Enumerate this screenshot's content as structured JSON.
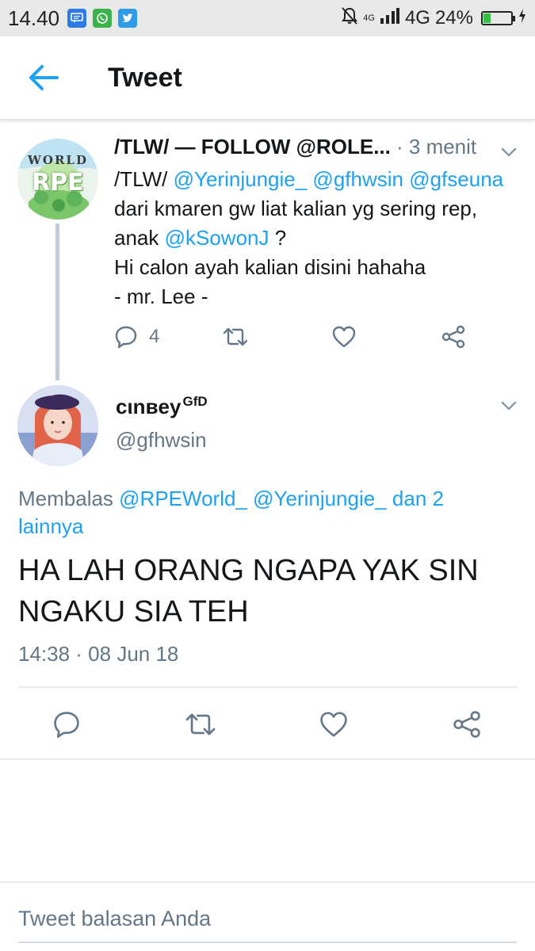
{
  "status_bar": {
    "time": "14.40",
    "network_small": "4G",
    "network": "4G",
    "battery_text": "24%",
    "battery_level": 0.24,
    "notification_icons": [
      "message-icon",
      "whatsapp-icon",
      "twitter-icon"
    ]
  },
  "header": {
    "title": "Tweet",
    "back_icon": "arrow-left-icon"
  },
  "parent_tweet": {
    "name": "/TLW/ — FOLLOW @ROLE...",
    "time": "· 3 menit",
    "avatar_text": "WORLD",
    "avatar_mark": "RPE",
    "text_parts": {
      "p1": "/TLW/ ",
      "m1": "@Yerinjungie_",
      "p2": " ",
      "m2": "@gfhwsin",
      "m3": "@gfseuna",
      "p3": " dari kmaren gw liat kalian yg sering rep, anak ",
      "m4": "@kSowonJ",
      "p4": " ?",
      "line2": "Hi calon ayah kalian disini hahaha",
      "line3": "- mr. Lee -"
    },
    "reply_count": "4"
  },
  "main_tweet": {
    "name": "cιnвey",
    "name_sup": "GfD",
    "handle": "@gfhwsin",
    "reply_prefix": "Membalas ",
    "reply_mentions": "@RPEWorld_ @Yerinjungie_ dan 2 lainnya",
    "text": "HA LAH ORANG NGAPA YAK SIN NGAKU SIA TEH",
    "timestamp": "14:38 · 08 Jun 18"
  },
  "composer": {
    "placeholder": "Tweet balasan Anda"
  },
  "colors": {
    "accent": "#1da1f2",
    "secondary_text": "#657786",
    "icon": "#657786"
  }
}
